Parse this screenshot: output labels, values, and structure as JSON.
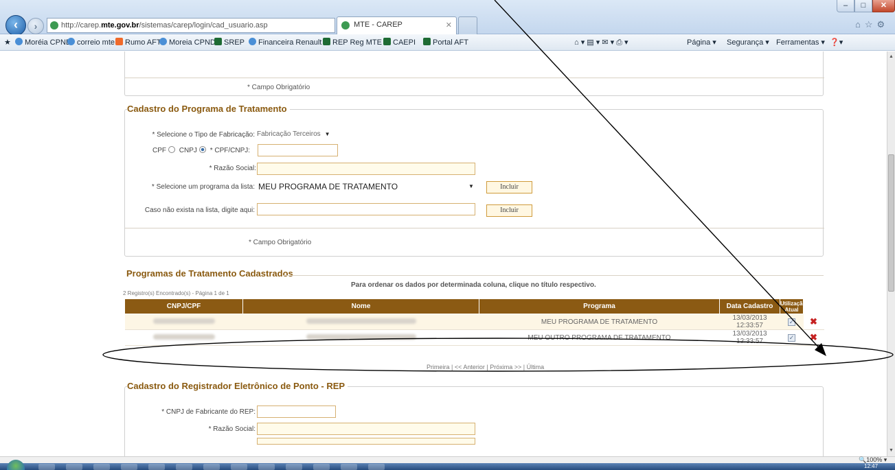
{
  "browser": {
    "url_prefix": "http://carep.",
    "url_domain": "mte.gov.br",
    "url_path": "/sistemas/carep/login/cad_usuario.asp",
    "url_actions": "▾ ⟳ ✕",
    "tab_title": "MTE - CAREP",
    "tab_close": "✕",
    "favorites": [
      "Moréia CPND",
      "correio mte",
      "Rumo AFT",
      "Moreia CPND",
      "SREP",
      "Financeira Renault",
      "REP Reg MTE",
      "CAEPI",
      "Portal AFT"
    ],
    "commands": {
      "page": "Página ▾",
      "security": "Segurança ▾",
      "tools": "Ferramentas ▾"
    },
    "zoom": "100%",
    "clock": "12:47"
  },
  "top_section": {
    "required_note": "* Campo Obrigatório"
  },
  "programa": {
    "title": "Cadastro do Programa de Tratamento",
    "tipo_label": "* Selecione o Tipo de Fabricação:",
    "tipo_value": "Fabricação Terceiros",
    "cpf_label": "CPF",
    "cnpj_label": "CNPJ",
    "cpfcnpj_label": "* CPF/CNPJ:",
    "cpfcnpj_value": "",
    "razao_label": "* Razão Social:",
    "razao_value": "",
    "lista_label": "* Selecione um programa da lista:",
    "lista_value": "MEU PROGRAMA DE TRATAMENTO",
    "incluir_label": "Incluir",
    "outro_label": "Caso não exista na lista, digite aqui:",
    "outro_value": "",
    "incluir2_label": "Incluir",
    "required_note": "* Campo Obrigatório"
  },
  "cadastrados": {
    "title": "Programas de Tratamento Cadastrados",
    "hint": "Para ordenar os dados por determinada coluna, clique no título respectivo.",
    "count": "2 Registro(s) Encontrado(s) - Página 1 de 1",
    "columns": [
      "CNPJ/CPF",
      "Nome",
      "Programa",
      "Data Cadastro",
      "Utilização Atual"
    ],
    "rows": [
      {
        "programa": "MEU PROGRAMA DE TRATAMENTO",
        "data": "13/03/2013",
        "hora": "12:33:57",
        "checked": "✓"
      },
      {
        "programa": "MEU OUTRO PROGRAMA DE TRATAMENTO",
        "data": "13/03/2013",
        "hora": "12:33:57",
        "checked": "✓"
      }
    ],
    "delete_glyph": "✖",
    "pager": "Primeira | << Anterior | Próxima >> | Última"
  },
  "rep": {
    "title": "Cadastro do Registrador Eletrônico de Ponto - REP",
    "cnpj_label": "* CNPJ de Fabricante do REP:",
    "cnpj_value": "",
    "razao_label": "* Razão Social:",
    "razao_value": ""
  },
  "colors": {
    "section_title": "#8a5a10",
    "table_header": "#8b5a13",
    "input_border": "#d6b070",
    "input_fill": "#fffbea",
    "delete": "#c62222"
  }
}
